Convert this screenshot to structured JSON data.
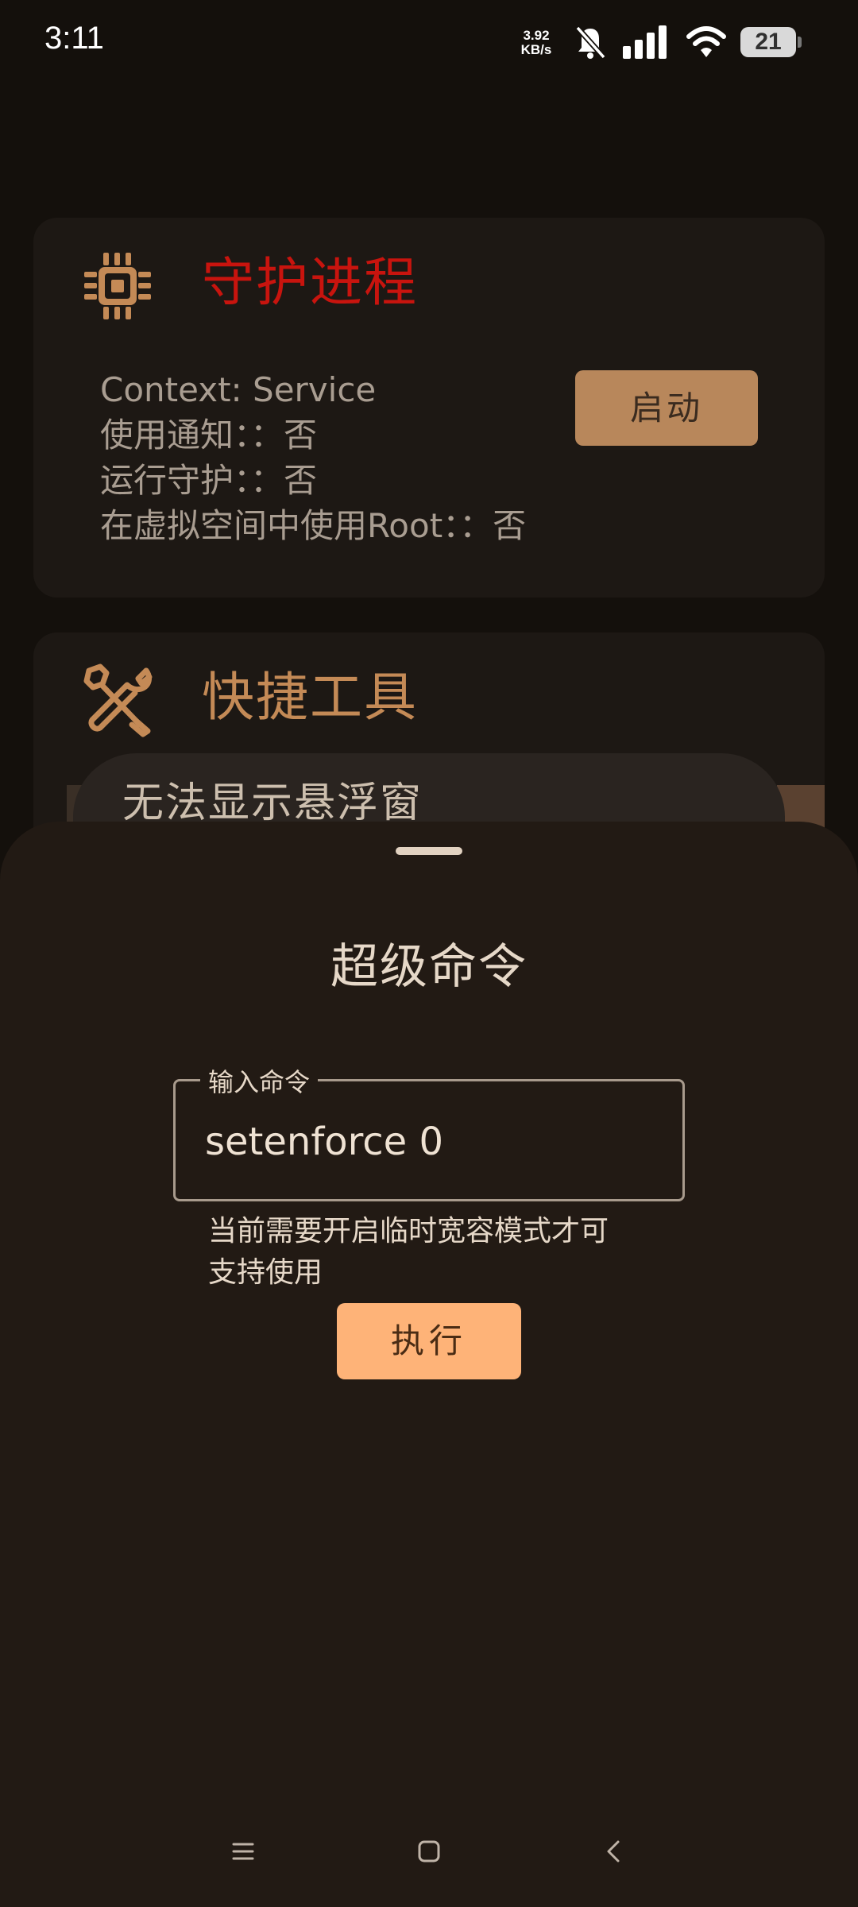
{
  "status_bar": {
    "time": "3:11",
    "net_speed_value": "3.92",
    "net_speed_unit": "KB/s",
    "battery": "21",
    "icons": [
      "mute-bell-icon",
      "signal-icon",
      "wifi-icon",
      "battery-icon"
    ]
  },
  "guard_card": {
    "title": "守护进程",
    "title_color": "#c8140e",
    "icon": "chip-icon",
    "lines": [
      "Context: Service",
      "使用通知：：否",
      "运行守护：：否",
      "在虚拟空间中使用Root：：否"
    ],
    "start_label": "启动"
  },
  "tools_card": {
    "title": "快捷工具",
    "title_color": "#c48a56",
    "icon": "wrench-screwdriver-icon"
  },
  "toast": {
    "text": "无法显示悬浮窗"
  },
  "sheet": {
    "title": "超级命令",
    "input_label": "输入命令",
    "input_value": "setenforce 0",
    "helper_line1": "当前需要开启临时宽容模式才可",
    "helper_line2": "支持使用",
    "execute_label": "执行",
    "accent_color": "#feb378"
  },
  "nav_bar": {
    "icons": [
      "menu-icon",
      "home-icon",
      "back-icon"
    ]
  }
}
